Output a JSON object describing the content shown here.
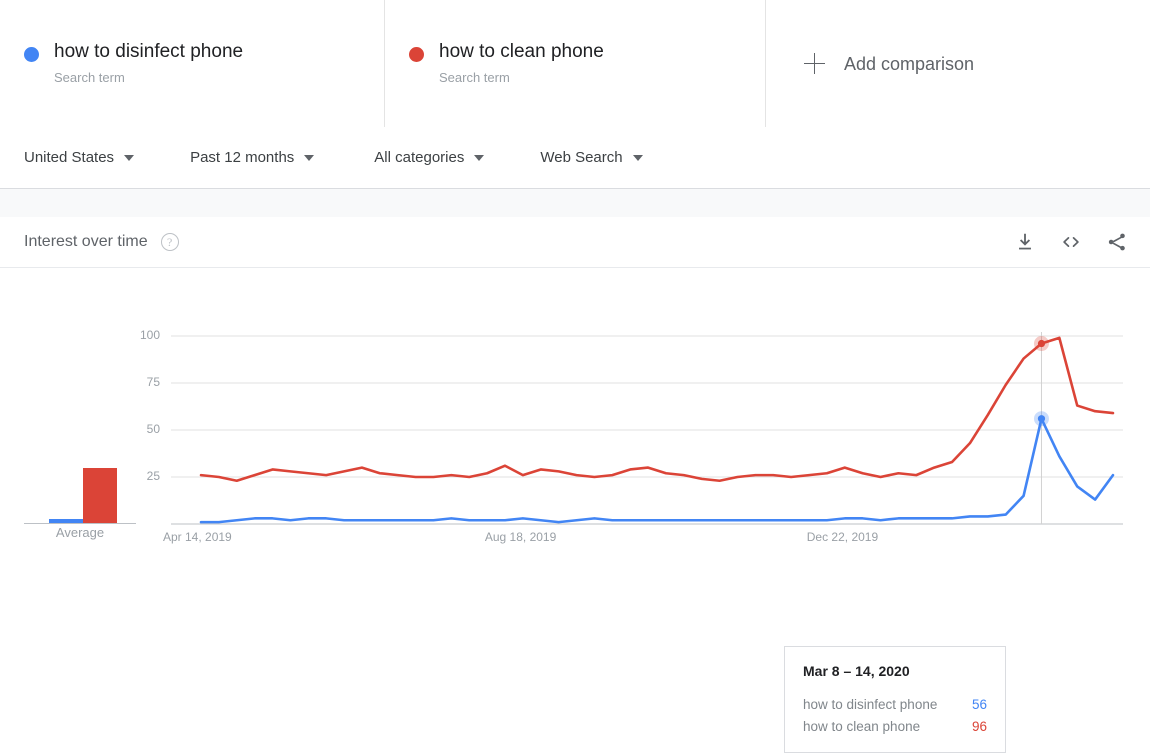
{
  "terms": [
    {
      "title": "how to disinfect phone",
      "subtitle": "Search term",
      "color": "#4285F4"
    },
    {
      "title": "how to clean phone",
      "subtitle": "Search term",
      "color": "#DB4437"
    }
  ],
  "add_comparison": {
    "label": "Add comparison",
    "icon": "plus-icon"
  },
  "filters": [
    {
      "label": "United States"
    },
    {
      "label": "Past 12 months"
    },
    {
      "label": "All categories"
    },
    {
      "label": "Web Search"
    }
  ],
  "section": {
    "title": "Interest over time",
    "help_icon": "?",
    "actions": [
      {
        "name": "download-icon"
      },
      {
        "name": "embed-code-icon"
      },
      {
        "name": "share-icon"
      }
    ]
  },
  "average_panel": {
    "label": "Average",
    "values": [
      2,
      29
    ]
  },
  "tooltip": {
    "date": "Mar 8 – 14, 2020",
    "rows": [
      {
        "label": "how to disinfect phone",
        "value": "56"
      },
      {
        "label": "how to clean phone",
        "value": "96"
      }
    ]
  },
  "chart_data": {
    "type": "line",
    "title": "Interest over time",
    "xlabel": "",
    "ylabel": "",
    "ylim": [
      0,
      100
    ],
    "yticks": [
      25,
      50,
      75,
      100
    ],
    "grid": true,
    "legend_position": "top-cards",
    "xticks": [
      {
        "index": 0,
        "label": "Apr 14, 2019"
      },
      {
        "index": 18,
        "label": "Aug 18, 2019"
      },
      {
        "index": 36,
        "label": "Dec 22, 2019"
      }
    ],
    "highlight": {
      "index": 47,
      "label": "Mar 8 – 14, 2020",
      "values": [
        56,
        96
      ]
    },
    "series": [
      {
        "name": "how to disinfect phone",
        "color": "#4285F4",
        "values": [
          1,
          1,
          2,
          3,
          3,
          2,
          3,
          3,
          2,
          2,
          2,
          2,
          2,
          2,
          3,
          2,
          2,
          2,
          3,
          2,
          1,
          2,
          3,
          2,
          2,
          2,
          2,
          2,
          2,
          2,
          2,
          2,
          2,
          2,
          2,
          2,
          3,
          3,
          2,
          3,
          3,
          3,
          3,
          4,
          4,
          5,
          15,
          56,
          36,
          20,
          13,
          26
        ]
      },
      {
        "name": "how to clean phone",
        "color": "#DB4437",
        "values": [
          26,
          25,
          23,
          26,
          29,
          28,
          27,
          26,
          28,
          30,
          27,
          26,
          25,
          25,
          26,
          25,
          27,
          31,
          26,
          29,
          28,
          26,
          25,
          26,
          29,
          30,
          27,
          26,
          24,
          23,
          25,
          26,
          26,
          25,
          26,
          27,
          30,
          27,
          25,
          27,
          26,
          30,
          33,
          43,
          58,
          74,
          88,
          96,
          99,
          63,
          60,
          59
        ]
      }
    ]
  }
}
